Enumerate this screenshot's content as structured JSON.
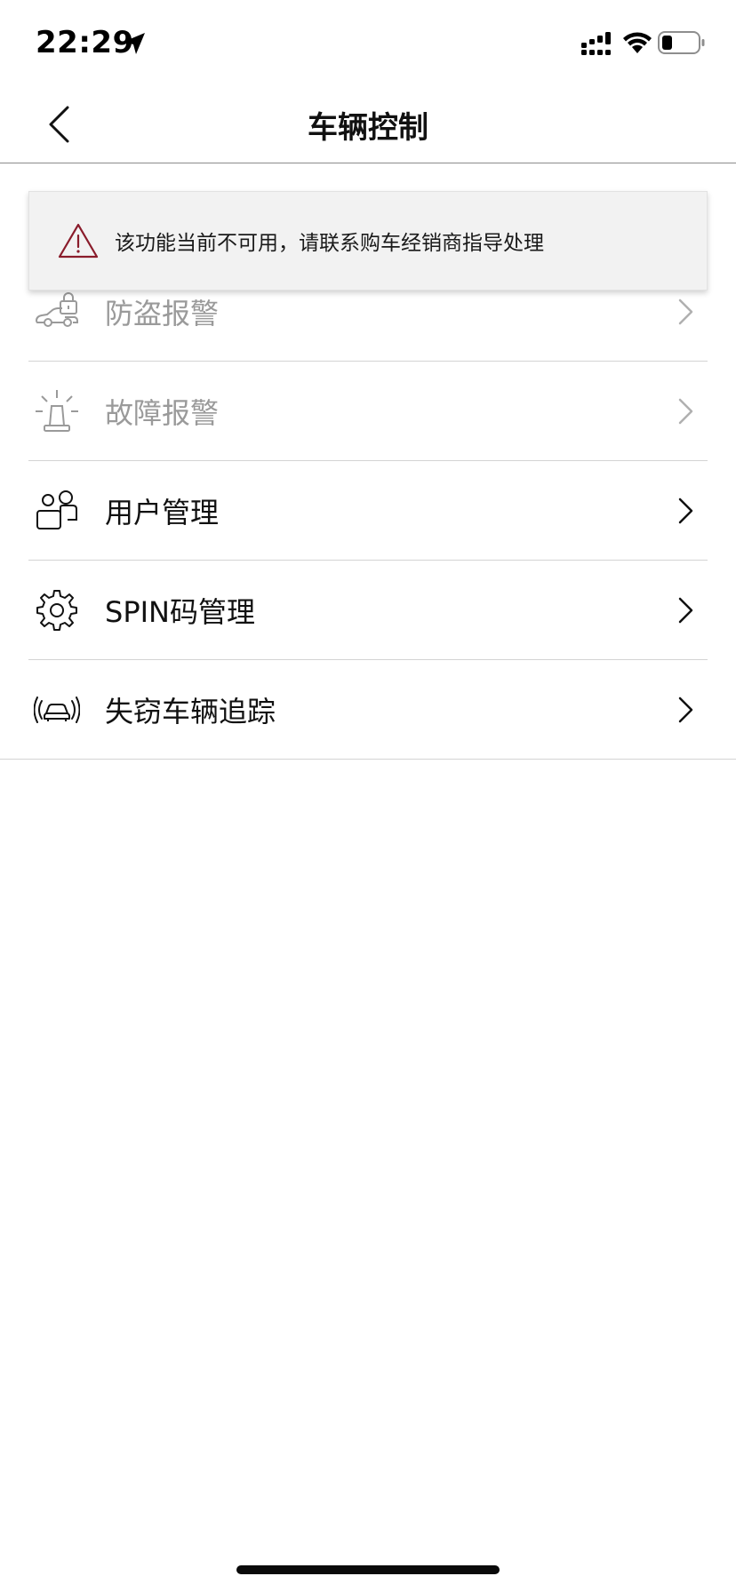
{
  "status_bar": {
    "time": "22:29",
    "icons": [
      "location-arrow-icon",
      "cellular-signal-icon",
      "wifi-icon",
      "battery-icon"
    ]
  },
  "nav": {
    "title": "车辆控制",
    "back_icon": "chevron-left-icon"
  },
  "toast": {
    "icon": "warning-triangle-icon",
    "message": "该功能当前不可用，请联系购车经销商指导处理",
    "accent_color": "#8a1c2b"
  },
  "menu": {
    "items": [
      {
        "label": "防盗报警",
        "icon": "car-lock-icon",
        "enabled": false
      },
      {
        "label": "故障报警",
        "icon": "siren-light-icon",
        "enabled": false
      },
      {
        "label": "用户管理",
        "icon": "users-icon",
        "enabled": true
      },
      {
        "label": "SPIN码管理",
        "icon": "gear-icon",
        "enabled": true
      },
      {
        "label": "失窃车辆追踪",
        "icon": "car-tracking-icon",
        "enabled": true
      }
    ]
  },
  "colors": {
    "text_primary": "#111111",
    "text_disabled": "#9a9a9a",
    "divider": "#d4d4d4",
    "toast_bg": "#f2f2f2"
  }
}
